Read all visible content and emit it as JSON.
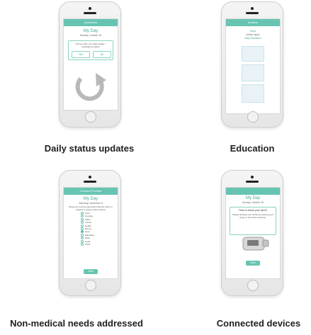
{
  "panels": [
    {
      "caption": "Daily status updates",
      "header": "Questions",
      "title": "My Day",
      "date": "Monday, October 26",
      "question": "Did you take your daily inhaler / medications today?",
      "yes": "Yes",
      "no": "No"
    },
    {
      "caption": "Education",
      "header": "Inhalers",
      "section_title": "Step",
      "section_sub": "Inhaler types",
      "link": "Daily Education"
    },
    {
      "caption": "Non-medical needs addressed",
      "header": "Connect Provider",
      "title": "My Day",
      "date": "Saturday, November 8",
      "prompt": "Please let us know generally what the call is in regards to (select option below):",
      "options": [
        "Food",
        "Housing",
        "Utility",
        "Transit",
        "Health",
        "Money",
        "Care",
        "Education",
        "Work",
        "Legal",
        "Other"
      ],
      "selected_index": 6,
      "button": "Next"
    },
    {
      "caption": "Connected devices",
      "header": "",
      "title": "My Day",
      "date": "Sunday, October 26",
      "check_title": "Time to check your SpO2",
      "instructions": "Please activate your device by placing your finger in the Pulse Oximeter",
      "button": "Next"
    }
  ]
}
